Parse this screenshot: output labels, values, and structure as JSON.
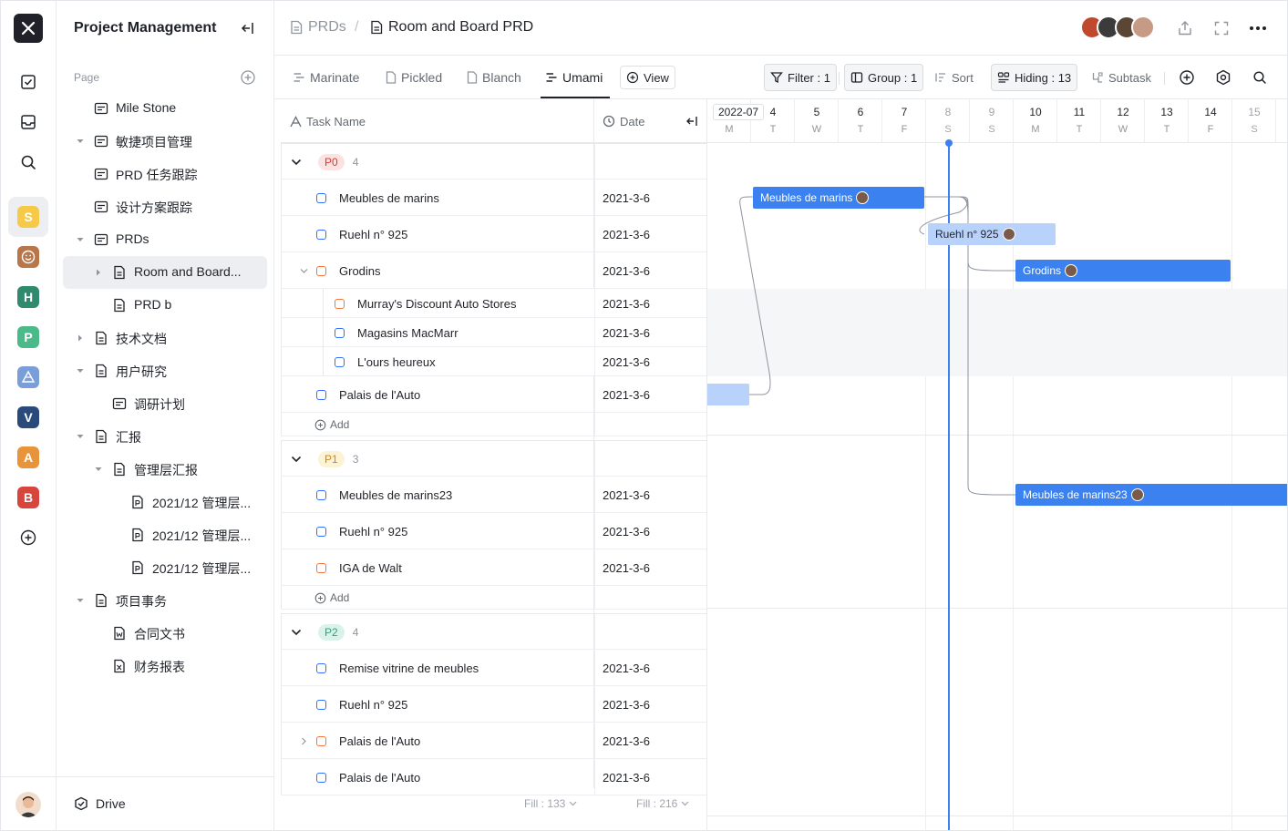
{
  "sidebar": {
    "title": "Project Management",
    "section_label": "Page",
    "items": [
      {
        "label": "Mile Stone"
      },
      {
        "label": "敏捷项目管理"
      },
      {
        "label": "PRD 任务跟踪"
      },
      {
        "label": "设计方案跟踪"
      },
      {
        "label": "PRDs"
      },
      {
        "label": "Room and Board..."
      },
      {
        "label": "PRD b"
      },
      {
        "label": "技术文档"
      },
      {
        "label": "用户研究"
      },
      {
        "label": "调研计划"
      },
      {
        "label": "汇报"
      },
      {
        "label": "管理层汇报"
      },
      {
        "label": "2021/12 管理层..."
      },
      {
        "label": "2021/12 管理层..."
      },
      {
        "label": "2021/12 管理层..."
      },
      {
        "label": "项目事务"
      },
      {
        "label": "合同文书"
      },
      {
        "label": "财务报表"
      }
    ],
    "drive_label": "Drive"
  },
  "rail": {
    "spaces": [
      {
        "letter": "S",
        "color": "#f7c948"
      },
      {
        "letter": "",
        "color": "#b8764a"
      },
      {
        "letter": "H",
        "color": "#2f8a6e"
      },
      {
        "letter": "P",
        "color": "#4cb98a"
      },
      {
        "letter": "",
        "color": "#7a9fd8"
      },
      {
        "letter": "V",
        "color": "#2a4a7c"
      },
      {
        "letter": "A",
        "color": "#e8943a"
      },
      {
        "letter": "B",
        "color": "#d8453d"
      }
    ]
  },
  "header": {
    "crumb_parent": "PRDs",
    "crumb_separator": "/",
    "crumb_current": "Room and Board PRD"
  },
  "viewbar": {
    "tabs": [
      {
        "label": "Marinate"
      },
      {
        "label": "Pickled"
      },
      {
        "label": "Blanch"
      },
      {
        "label": "Umami"
      }
    ],
    "view_button": "View",
    "filter": "Filter : 1",
    "group": "Group : 1",
    "sort": "Sort",
    "hiding": "Hiding : 13",
    "subtask": "Subtask"
  },
  "table": {
    "col_task": "Task Name",
    "col_date": "Date",
    "add_label": "Add",
    "fill_left": "Fill : 133",
    "fill_right": "Fill : 216",
    "groups": [
      {
        "name": "P0",
        "count": "4",
        "rows": [
          {
            "name": "Meubles de marins",
            "date": "2021-3-6"
          },
          {
            "name": "Ruehl n° 925",
            "date": "2021-3-6"
          },
          {
            "name": "Grodins",
            "date": "2021-3-6"
          },
          {
            "name": "Murray's Discount Auto Stores",
            "date": "2021-3-6"
          },
          {
            "name": "Magasins MacMarr",
            "date": "2021-3-6"
          },
          {
            "name": "L'ours heureux",
            "date": "2021-3-6"
          },
          {
            "name": "Palais de l'Auto",
            "date": "2021-3-6"
          }
        ]
      },
      {
        "name": "P1",
        "count": "3",
        "rows": [
          {
            "name": "Meubles de marins23",
            "date": "2021-3-6"
          },
          {
            "name": "Ruehl n° 925",
            "date": "2021-3-6"
          },
          {
            "name": "IGA de Walt",
            "date": "2021-3-6"
          }
        ]
      },
      {
        "name": "P2",
        "count": "4",
        "rows": [
          {
            "name": "Remise vitrine de meubles",
            "date": "2021-3-6"
          },
          {
            "name": "Ruehl n° 925",
            "date": "2021-3-6"
          },
          {
            "name": "Palais de l'Auto",
            "date": "2021-3-6"
          },
          {
            "name": "Palais de l'Auto",
            "date": "2021-3-6"
          }
        ]
      }
    ]
  },
  "timeline": {
    "month": "2022-07",
    "days": [
      {
        "n": "",
        "w": "M"
      },
      {
        "n": "4",
        "w": "T"
      },
      {
        "n": "5",
        "w": "W"
      },
      {
        "n": "6",
        "w": "T"
      },
      {
        "n": "7",
        "w": "F"
      },
      {
        "n": "8",
        "w": "S"
      },
      {
        "n": "9",
        "w": "S"
      },
      {
        "n": "10",
        "w": "M"
      },
      {
        "n": "11",
        "w": "T"
      },
      {
        "n": "12",
        "w": "W"
      },
      {
        "n": "13",
        "w": "T"
      },
      {
        "n": "14",
        "w": "F"
      },
      {
        "n": "15",
        "w": "S"
      }
    ],
    "bars": [
      {
        "label": "Meubles de marins"
      },
      {
        "label": "Ruehl n° 925"
      },
      {
        "label": "Grodins"
      },
      {
        "label": ""
      },
      {
        "label": "Meubles de marins23"
      }
    ]
  }
}
